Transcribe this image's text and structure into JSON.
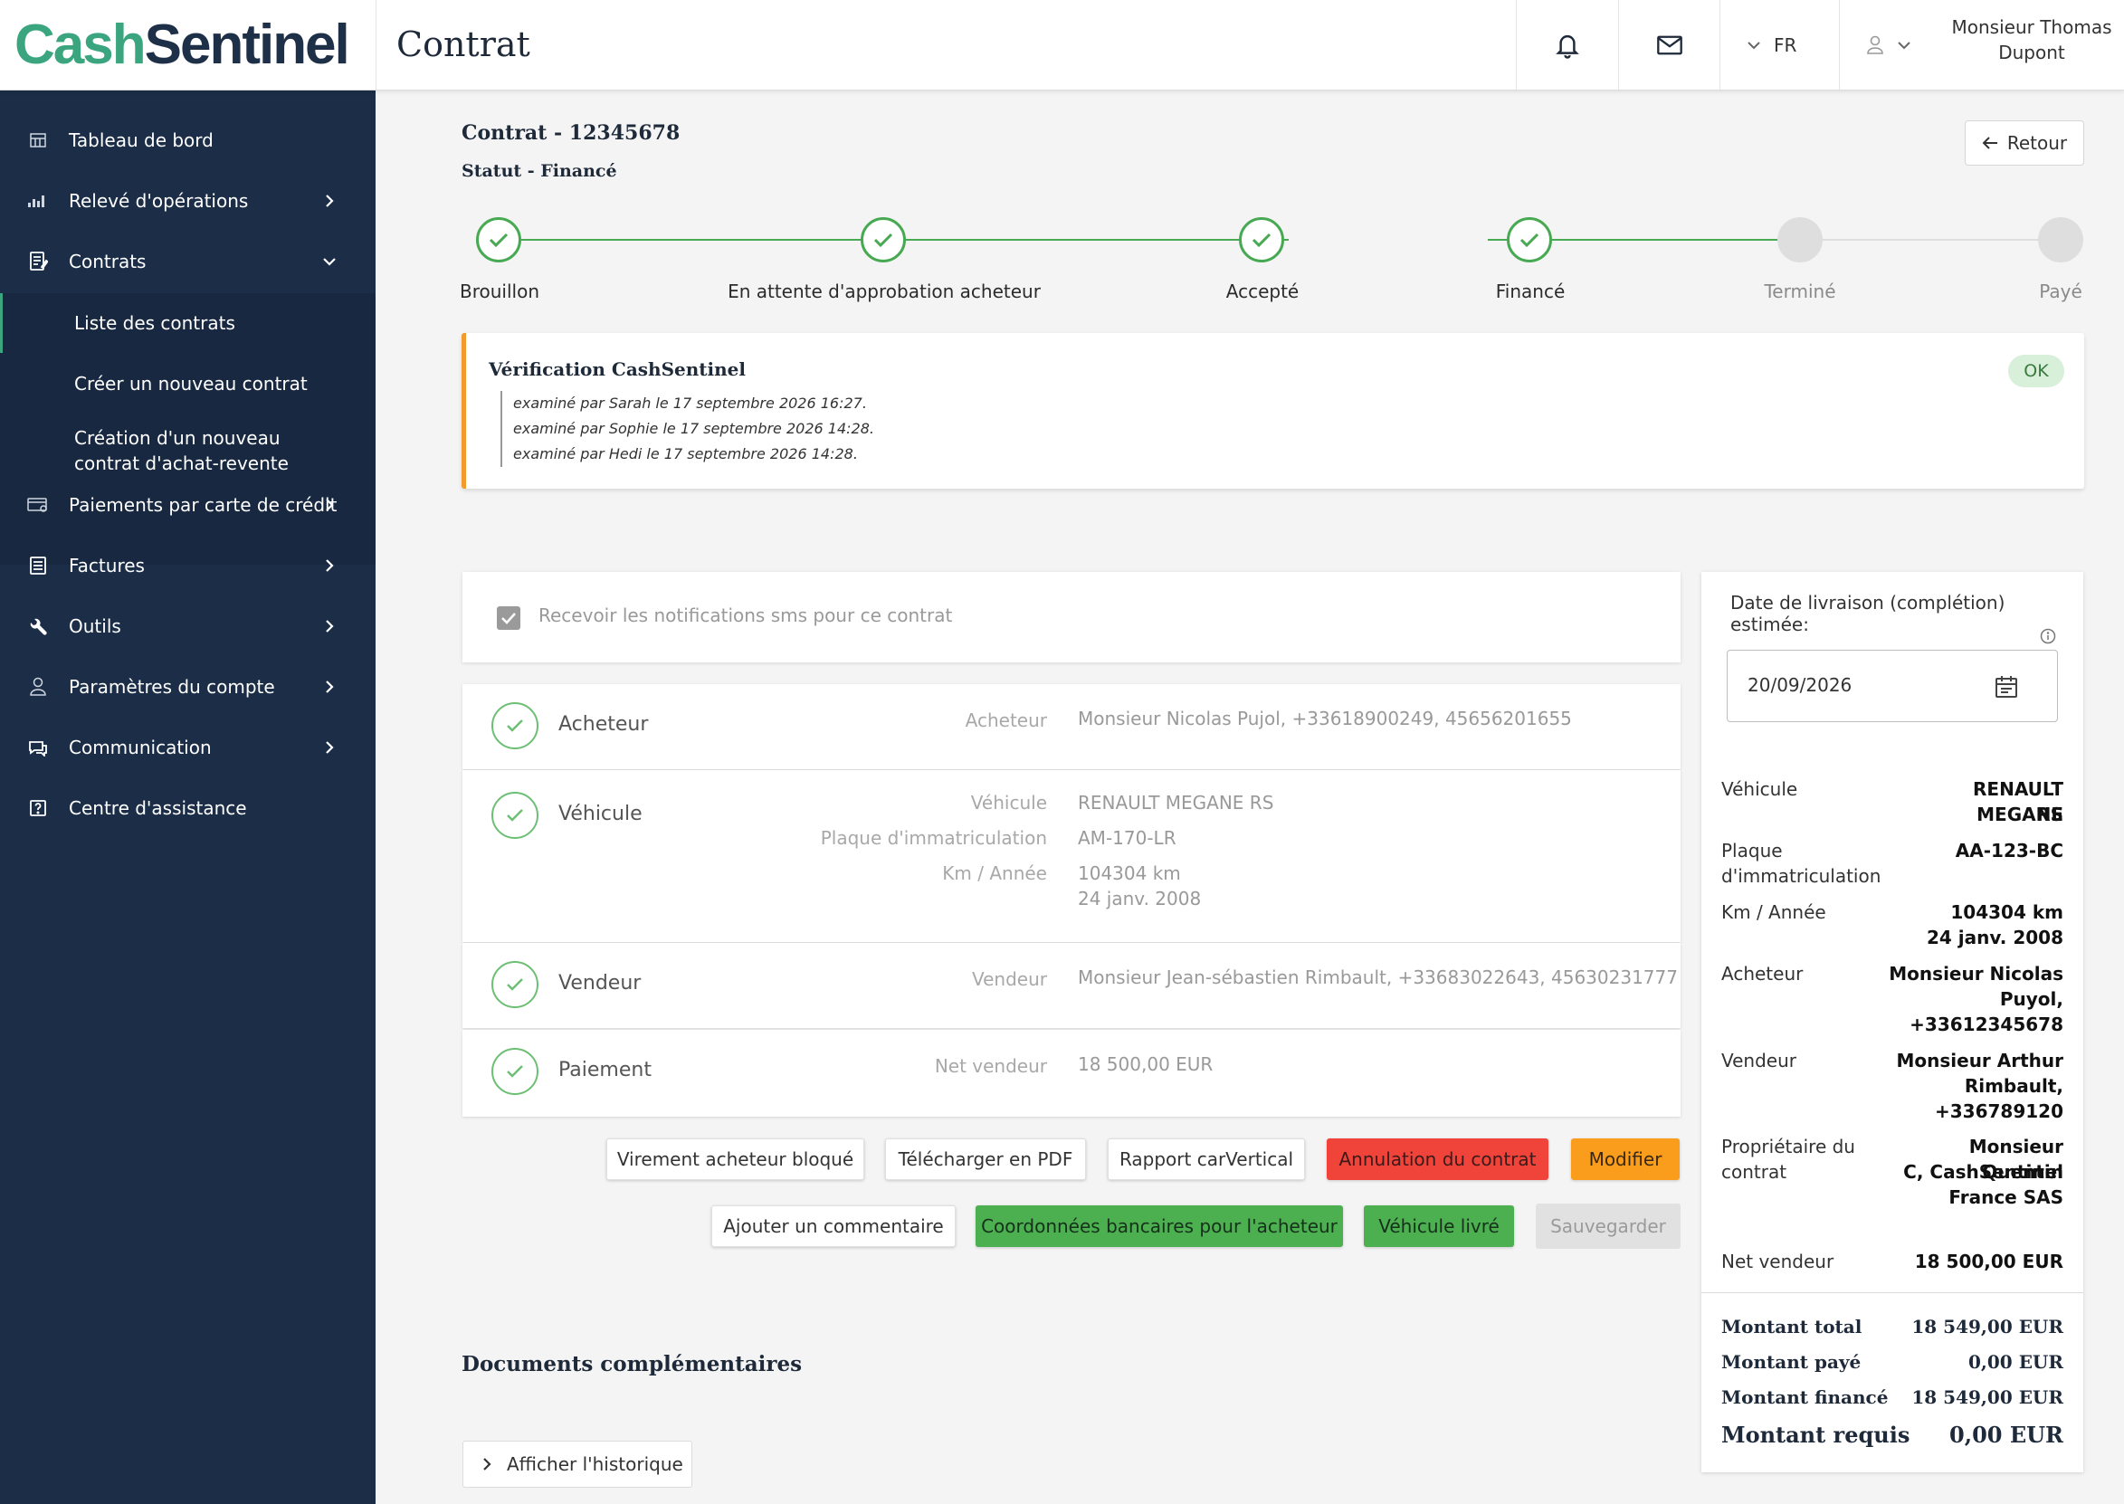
{
  "app": {
    "logo_part1": "Cash",
    "logo_part2": "Sentinel",
    "page_title": "Contrat",
    "lang": "FR",
    "user_name_line1": "Monsieur Thomas",
    "user_name_line2": "Dupont"
  },
  "sidebar": {
    "items": [
      {
        "label": "Tableau de bord",
        "icon": "dashboard-icon"
      },
      {
        "label": "Relevé d'opérations",
        "icon": "chart-icon"
      },
      {
        "label": "Contrats",
        "icon": "contract-icon"
      },
      {
        "label": "Paiements par carte de crédit",
        "icon": "credit-card-icon"
      },
      {
        "label": "Factures",
        "icon": "invoice-icon"
      },
      {
        "label": "Outils",
        "icon": "wrench-icon"
      },
      {
        "label": "Paramètres du compte",
        "icon": "user-icon"
      },
      {
        "label": "Communication",
        "icon": "chat-icon"
      },
      {
        "label": "Centre d'assistance",
        "icon": "help-icon"
      }
    ],
    "submenu": [
      {
        "label": "Liste des contrats"
      },
      {
        "label": "Créer un nouveau contrat"
      },
      {
        "label": "Création d'un nouveau contrat d'achat-revente"
      }
    ]
  },
  "contract": {
    "title": "Contrat - 12345678",
    "status": "Statut - Financé",
    "back_label": "Retour"
  },
  "stepper": {
    "steps": [
      {
        "label": "Brouillon",
        "done": true
      },
      {
        "label": "En attente d'approbation acheteur",
        "done": true
      },
      {
        "label": "Accepté",
        "done": true
      },
      {
        "label": "Financé",
        "done": true
      },
      {
        "label": "Terminé",
        "done": false
      },
      {
        "label": "Payé",
        "done": false
      }
    ],
    "done_color": "#47a952",
    "todo_color": "#dedede"
  },
  "verification": {
    "title": "Vérification CashSentinel",
    "badge": "OK",
    "lines": [
      "examiné par Sarah le 17 septembre 2026 16:27.",
      "examiné par Sophie le 17 septembre 2026 14:28.",
      "examiné par Hedi le 17 septembre 2026 14:28."
    ]
  },
  "sms": {
    "label": "Recevoir les notifications sms pour ce contrat",
    "checked": true
  },
  "sections": {
    "buyer": {
      "title": "Acheteur",
      "field_label": "Acheteur",
      "field_value": "Monsieur Nicolas Pujol, +33618900249, 45656201655"
    },
    "vehicle": {
      "title": "Véhicule",
      "vehicle_label": "Véhicule",
      "vehicle_value": "RENAULT  MEGANE RS",
      "plate_label": "Plaque d'immatriculation",
      "plate_value": "AM-170-LR",
      "km_label": "Km / Année",
      "km_value": "104304  km",
      "year_value": "24 janv. 2008"
    },
    "seller": {
      "title": "Vendeur",
      "field_label": "Vendeur",
      "field_value": "Monsieur Jean-sébastien Rimbault, +33683022643, 45630231777"
    },
    "payment": {
      "title": "Paiement",
      "field_label": "Net vendeur",
      "field_value": "18 500,00 EUR"
    }
  },
  "actions": {
    "row1": [
      "Virement acheteur bloqué",
      "Télécharger en PDF",
      "Rapport carVertical",
      "Annulation du contrat",
      "Modifier"
    ],
    "row2": [
      "Ajouter un commentaire",
      "Coordonnées bancaires pour l'acheteur",
      "Véhicule livré",
      "Sauvegarder"
    ],
    "colors": {
      "danger": "#f0443a",
      "warning": "#fa9d1c",
      "success": "#4caf50"
    }
  },
  "documents": {
    "title": "Documents complémentaires",
    "history_label": "Afficher l'historique"
  },
  "summary": {
    "delivery_label": "Date de livraison (complétion) estimée:",
    "delivery_date": "20/09/2026",
    "vehicle_label": "Véhicule",
    "vehicle_value_1": "RENAULT  MEGANE",
    "vehicle_value_2": "RS",
    "plate_label_1": "Plaque",
    "plate_label_2": "d'immatriculation",
    "plate_value": "AA-123-BC",
    "km_label": "Km / Année",
    "km_value": "104304  km",
    "year_value": "24 janv. 2008",
    "buyer_label": "Acheteur",
    "buyer_value_1": "Monsieur Nicolas",
    "buyer_value_2": "Puyol,",
    "buyer_value_3": "+33612345678",
    "seller_label": "Vendeur",
    "seller_value_1": "Monsieur Arthur",
    "seller_value_2": "Rimbault,",
    "seller_value_3": "+336789120",
    "owner_label_1": "Propriétaire du",
    "owner_label_2": "contrat",
    "owner_value_1": "Monsieur Quentin",
    "owner_value_2": "C, CashSentinel",
    "owner_value_3": "France SAS",
    "net_label": "Net vendeur",
    "net_value": "18 500,00 EUR",
    "total_label": "Montant total",
    "total_value": "18 549,00 EUR",
    "paid_label": "Montant payé",
    "paid_value": "0,00 EUR",
    "financed_label": "Montant financé",
    "financed_value": "18 549,00 EUR",
    "required_label": "Montant requis",
    "required_value": "0,00 EUR"
  }
}
